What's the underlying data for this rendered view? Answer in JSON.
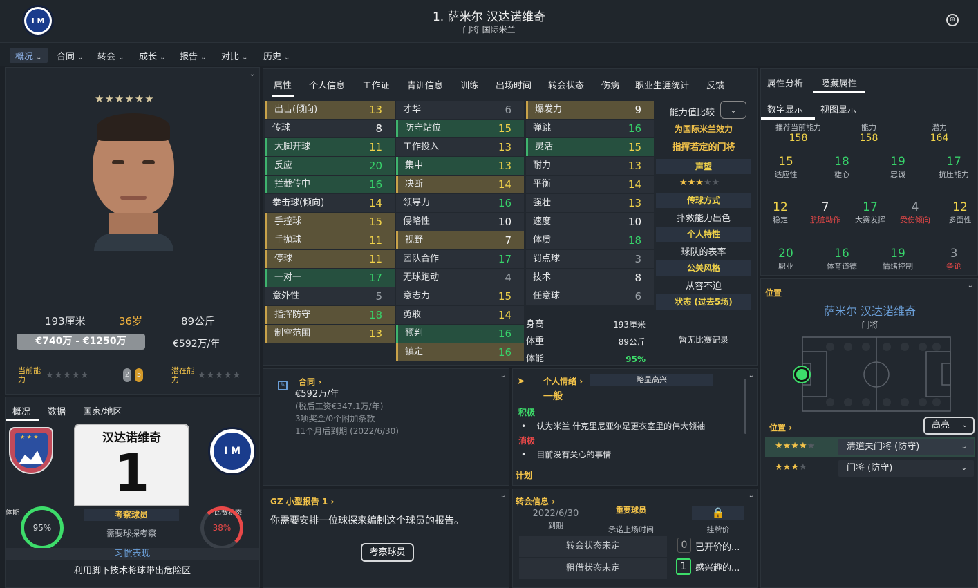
{
  "header": {
    "title": "1. 萨米尔 汉达诺维奇",
    "subtitle": "门将-国际米兰",
    "club_logo": "inter-logo",
    "right_icon": "globe-icon"
  },
  "nav": [
    "概况",
    "合同",
    "转会",
    "成长",
    "报告",
    "对比",
    "历史"
  ],
  "profile": {
    "stars": "★★★★★★",
    "height": "193厘米",
    "age": "36岁",
    "weight": "89公斤",
    "value": "€740万 - €1250万",
    "wage": "€592万/年",
    "current_ability": "当前能力",
    "potential_ability": "潜在能力",
    "badge1": "2",
    "badge2": "5"
  },
  "bottom_left": {
    "tabs": [
      "概况",
      "数据",
      "国家/地区"
    ],
    "shirt_name": "汉达诺维奇",
    "shirt_number": "1",
    "scout_label": "考察球员",
    "scout_need": "需要球探考察",
    "fitness_label": "体能",
    "fitness_value": "95%",
    "match_label": "比赛状态",
    "match_value": "38%",
    "habit_title": "习惯表现",
    "habit_text": "利用脚下技术将球带出危险区"
  },
  "attr_tabs": [
    "属性",
    "个人信息",
    "工作证",
    "青训信息",
    "训练",
    "出场时间",
    "转会状态",
    "伤病",
    "职业生涯统计",
    "反馈"
  ],
  "attributes": {
    "col1": [
      {
        "n": "出击(倾向)",
        "v": "13",
        "h": "y"
      },
      {
        "n": "传球",
        "v": "8",
        "h": "p"
      },
      {
        "n": "大脚开球",
        "v": "11",
        "h": "g"
      },
      {
        "n": "反应",
        "v": "20",
        "h": "g"
      },
      {
        "n": "拦截传中",
        "v": "16",
        "h": "g"
      },
      {
        "n": "拳击球(倾向)",
        "v": "14",
        "h": "p"
      },
      {
        "n": "手控球",
        "v": "15",
        "h": "y"
      },
      {
        "n": "手抛球",
        "v": "11",
        "h": "y"
      },
      {
        "n": "停球",
        "v": "11",
        "h": "y"
      },
      {
        "n": "一对一",
        "v": "17",
        "h": "g"
      },
      {
        "n": "意外性",
        "v": "5",
        "h": "p"
      },
      {
        "n": "指挥防守",
        "v": "18",
        "h": "y"
      },
      {
        "n": "制空范围",
        "v": "13",
        "h": "y"
      }
    ],
    "col2": [
      {
        "n": "才华",
        "v": "6",
        "h": "p"
      },
      {
        "n": "防守站位",
        "v": "15",
        "h": "g"
      },
      {
        "n": "工作投入",
        "v": "13",
        "h": "p"
      },
      {
        "n": "集中",
        "v": "13",
        "h": "g"
      },
      {
        "n": "决断",
        "v": "14",
        "h": "y"
      },
      {
        "n": "领导力",
        "v": "16",
        "h": "p"
      },
      {
        "n": "侵略性",
        "v": "10",
        "h": "p"
      },
      {
        "n": "视野",
        "v": "7",
        "h": "y"
      },
      {
        "n": "团队合作",
        "v": "17",
        "h": "p"
      },
      {
        "n": "无球跑动",
        "v": "4",
        "h": "p"
      },
      {
        "n": "意志力",
        "v": "15",
        "h": "p"
      },
      {
        "n": "勇敢",
        "v": "14",
        "h": "p"
      },
      {
        "n": "预判",
        "v": "16",
        "h": "g"
      },
      {
        "n": "镇定",
        "v": "16",
        "h": "y"
      }
    ],
    "col3": [
      {
        "n": "爆发力",
        "v": "9",
        "h": "y"
      },
      {
        "n": "弹跳",
        "v": "16",
        "h": "p"
      },
      {
        "n": "灵活",
        "v": "15",
        "h": "g"
      },
      {
        "n": "耐力",
        "v": "13",
        "h": "p"
      },
      {
        "n": "平衡",
        "v": "14",
        "h": "p"
      },
      {
        "n": "强壮",
        "v": "13",
        "h": "p"
      },
      {
        "n": "速度",
        "v": "10",
        "h": "p"
      },
      {
        "n": "体质",
        "v": "18",
        "h": "p"
      },
      {
        "n": "罚点球",
        "v": "3",
        "h": "p"
      },
      {
        "n": "技术",
        "v": "8",
        "h": "p"
      },
      {
        "n": "任意球",
        "v": "6",
        "h": "p"
      }
    ],
    "body": [
      {
        "n": "身高",
        "v": "193厘米"
      },
      {
        "n": "体重",
        "v": "89公斤"
      },
      {
        "n": "体能",
        "v": "95%"
      }
    ]
  },
  "compare": {
    "label": "能力值比较",
    "plays_for": "为国际米兰效力",
    "command": "指挥若定的门将",
    "rep_title": "声望",
    "rep_stars": "★★★",
    "rep_empty": "★★",
    "pass_title": "传球方式",
    "pass_text": "扑救能力出色",
    "trait_title": "个人特性",
    "trait_text": "球队的表率",
    "pr_title": "公关风格",
    "pr_text": "从容不迫",
    "form_title": "状态 (过去5场)",
    "form_text": "暂无比赛记录"
  },
  "contract": {
    "title": "合同",
    "wage": "€592万/年",
    "after_tax": "(税后工资€347.1万/年)",
    "bonus": "3项奖金/0个附加条款",
    "expire": "11个月后到期 (2022/6/30)"
  },
  "mood": {
    "title": "个人情绪",
    "badge": "略显高兴",
    "level": "一般",
    "pos_title": "积极",
    "pos_item": "认为米兰 什克里尼亚尔是更衣室里的伟大领袖",
    "neg_title": "消极",
    "neg_item": "目前没有关心的事情",
    "plan_title": "计划"
  },
  "report": {
    "title": "GZ 小型报告 1",
    "text": "你需要安排一位球探来编制这个球员的报告。",
    "button": "考察球员"
  },
  "transfer": {
    "title": "转会信息",
    "date": "2022/6/30",
    "date_label": "到期",
    "status": "重要球员",
    "status_label": "承诺上场时间",
    "price_label": "挂牌价",
    "transfer_status": "转会状态未定",
    "loan_status": "租借状态未定",
    "offers_count": "0",
    "offers_label": "已开价的...",
    "interest_count": "1",
    "interest_label": "感兴趣的..."
  },
  "hidden": {
    "tabs": [
      "属性分析",
      "隐藏属性"
    ],
    "view_tabs": [
      "数字显示",
      "视图显示"
    ],
    "top": [
      {
        "l": "推荐当前能力",
        "v": "158"
      },
      {
        "l": "能力",
        "v": "158"
      },
      {
        "l": "潜力",
        "v": "164"
      }
    ],
    "row1": [
      {
        "l": "适应性",
        "v": "15",
        "c": "y"
      },
      {
        "l": "雄心",
        "v": "18",
        "c": "g"
      },
      {
        "l": "忠诚",
        "v": "19",
        "c": "g"
      },
      {
        "l": "抗压能力",
        "v": "17",
        "c": "g"
      }
    ],
    "row2": [
      {
        "l": "稳定",
        "v": "12",
        "c": "y"
      },
      {
        "l": "肮脏动作",
        "v": "7",
        "c": "w",
        "lc": "r"
      },
      {
        "l": "大赛发挥",
        "v": "17",
        "c": "g"
      },
      {
        "l": "受伤倾向",
        "v": "4",
        "c": "gr",
        "lc": "r"
      },
      {
        "l": "多面性",
        "v": "12",
        "c": "y"
      }
    ],
    "row3": [
      {
        "l": "职业",
        "v": "20",
        "c": "g"
      },
      {
        "l": "体育道德",
        "v": "16",
        "c": "g"
      },
      {
        "l": "情绪控制",
        "v": "19",
        "c": "g"
      },
      {
        "l": "争论",
        "v": "3",
        "c": "gr",
        "lc": "r"
      }
    ]
  },
  "position": {
    "title": "位置",
    "name": "萨米尔 汉达诺维奇",
    "role": "门将",
    "pos_link": "位置",
    "dropdown": "高亮",
    "role1": "清道夫门将 (防守)",
    "role2": "门将 (防守)",
    "role1_stars": "★★★★",
    "role2_stars": "★★★"
  }
}
